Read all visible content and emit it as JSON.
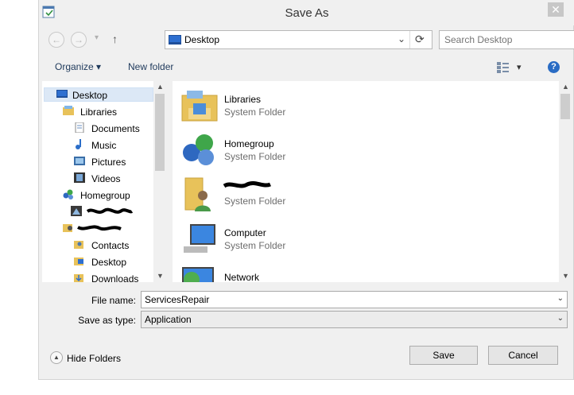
{
  "window": {
    "title": "Save As",
    "close_glyph": "✕"
  },
  "nav": {
    "back_glyph": "←",
    "forward_glyph": "→",
    "dropdown_glyph": "▾",
    "up_glyph": "↑",
    "address_text": "Desktop",
    "refresh_glyph": "⟳",
    "address_dropdown_glyph": "⌄",
    "search_placeholder": "Search Desktop",
    "search_glyph": "⚲"
  },
  "toolbar": {
    "organize_label": "Organize ▾",
    "new_folder_label": "New folder",
    "view_glyph": "▾",
    "help_glyph": "?"
  },
  "sidebar": {
    "items": [
      {
        "label": "Desktop",
        "icon": "desktop-icon"
      },
      {
        "label": "Libraries",
        "icon": "libraries-icon"
      },
      {
        "label": "Documents",
        "icon": "documents-icon"
      },
      {
        "label": "Music",
        "icon": "music-icon"
      },
      {
        "label": "Pictures",
        "icon": "pictures-icon"
      },
      {
        "label": "Videos",
        "icon": "videos-icon"
      },
      {
        "label": "Homegroup",
        "icon": "homegroup-icon"
      },
      {
        "label": "",
        "icon": "redacted-icon"
      },
      {
        "label": "",
        "icon": "user-folder-icon"
      },
      {
        "label": "Contacts",
        "icon": "contacts-icon"
      },
      {
        "label": "Desktop",
        "icon": "folder-icon"
      },
      {
        "label": "Downloads",
        "icon": "downloads-icon"
      }
    ]
  },
  "content": {
    "items": [
      {
        "name": "Libraries",
        "type": "System Folder",
        "icon": "libraries-icon"
      },
      {
        "name": "Homegroup",
        "type": "System Folder",
        "icon": "homegroup-icon"
      },
      {
        "name": "",
        "type": "System Folder",
        "icon": "user-folder-icon"
      },
      {
        "name": "Computer",
        "type": "System Folder",
        "icon": "computer-icon"
      },
      {
        "name": "Network",
        "type": "",
        "icon": "network-icon"
      }
    ]
  },
  "form": {
    "file_name_label": "File name:",
    "file_name_value": "ServicesRepair",
    "save_as_type_label": "Save as type:",
    "save_as_type_value": "Application"
  },
  "footer": {
    "hide_folders_label": "Hide Folders",
    "save_label": "Save",
    "cancel_label": "Cancel"
  }
}
